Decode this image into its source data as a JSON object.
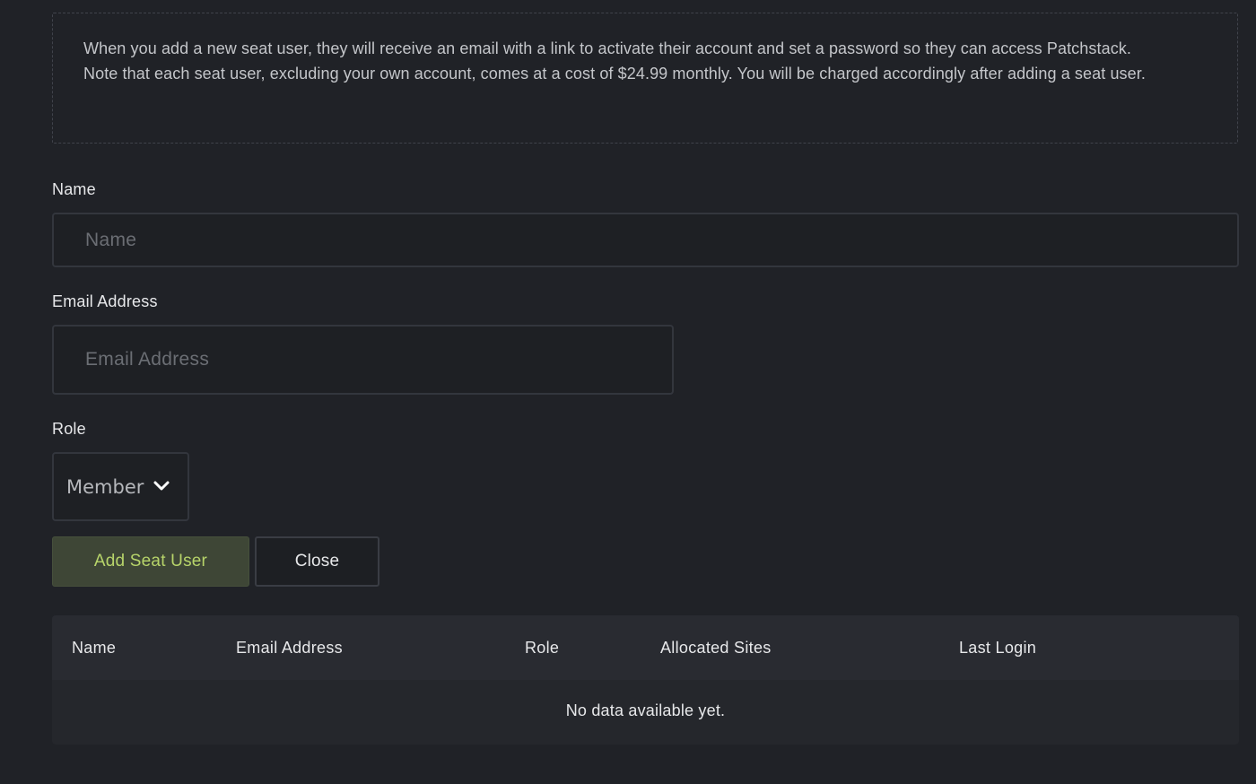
{
  "notice": {
    "line1": "When you add a new seat user, they will receive an email with a link to activate their account and set a password so they can access Patchstack.",
    "line2": "Note that each seat user, excluding your own account, comes at a cost of $24.99 monthly. You will be charged accordingly after adding a seat user."
  },
  "form": {
    "name_label": "Name",
    "name_placeholder": "Name",
    "email_label": "Email Address",
    "email_placeholder": "Email Address",
    "role_label": "Role",
    "role_selected": "Member",
    "role_icon": "chevron-down-icon",
    "add_button": "Add Seat User",
    "close_button": "Close"
  },
  "table": {
    "columns": [
      "Name",
      "Email Address",
      "Role",
      "Allocated Sites",
      "Last Login"
    ],
    "empty_message": "No data available yet."
  },
  "colors": {
    "background": "#202227",
    "accent_text": "#b7d46a",
    "accent_bg": "#3e4636"
  }
}
